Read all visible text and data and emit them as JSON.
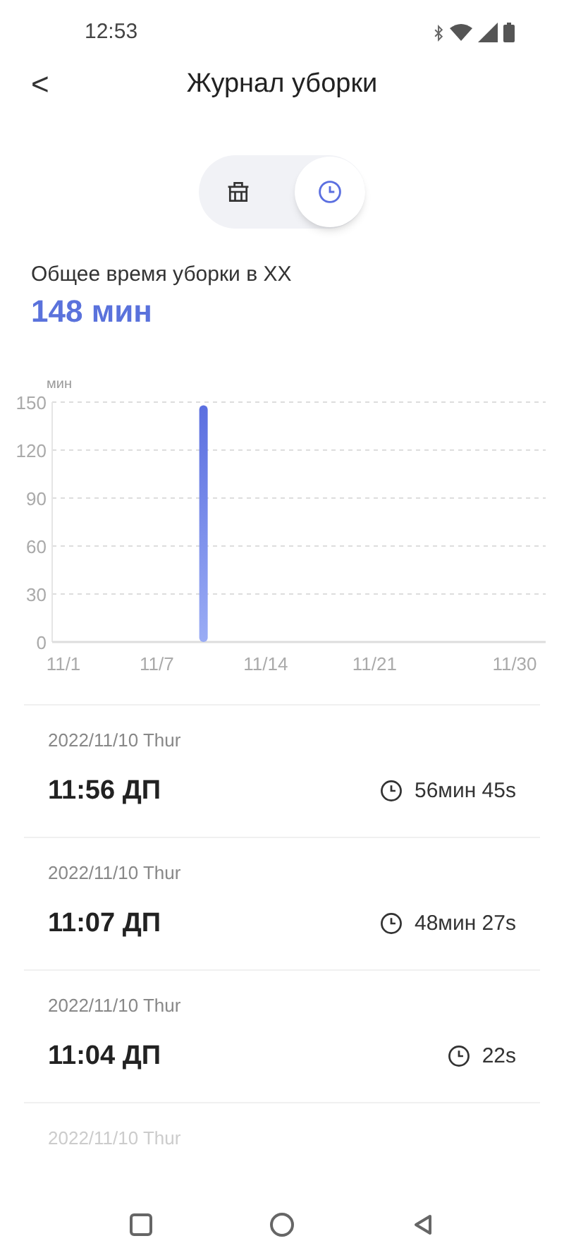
{
  "status_bar": {
    "time": "12:53"
  },
  "header": {
    "back": "<",
    "title": "Журнал уборки"
  },
  "view_toggle": [
    {
      "kind": "basket",
      "selected": false
    },
    {
      "kind": "clock",
      "selected": true
    }
  ],
  "summary": {
    "label": "Общее время уборки в XX",
    "value": "148 мин"
  },
  "chart": {
    "chart_data": {
      "type": "bar",
      "ylabel": "мин",
      "grid": true,
      "ylim": [
        0,
        150
      ],
      "yticks": [
        0,
        30,
        60,
        90,
        120,
        150
      ],
      "categories": [
        "11/1",
        null,
        null,
        null,
        null,
        null,
        "11/7",
        null,
        null,
        null,
        null,
        null,
        null,
        "11/14",
        null,
        null,
        null,
        null,
        null,
        null,
        "11/21",
        null,
        null,
        null,
        null,
        null,
        null,
        null,
        null,
        "11/30"
      ],
      "values": [
        null,
        null,
        null,
        null,
        null,
        null,
        null,
        null,
        null,
        148,
        null,
        null,
        null,
        null,
        null,
        null,
        null,
        null,
        null,
        null,
        null,
        null,
        null,
        null,
        null,
        null,
        null,
        null,
        null,
        null
      ]
    }
  },
  "records": [
    {
      "date": "2022/11/10 Thur",
      "time": "11:56 ДП",
      "duration": "56мин 45s"
    },
    {
      "date": "2022/11/10 Thur",
      "time": "11:07 ДП",
      "duration": "48мин 27s"
    },
    {
      "date": "2022/11/10 Thur",
      "time": "11:04 ДП",
      "duration": "22s"
    },
    {
      "date": "2022/11/10 Thur",
      "faded": true
    }
  ]
}
